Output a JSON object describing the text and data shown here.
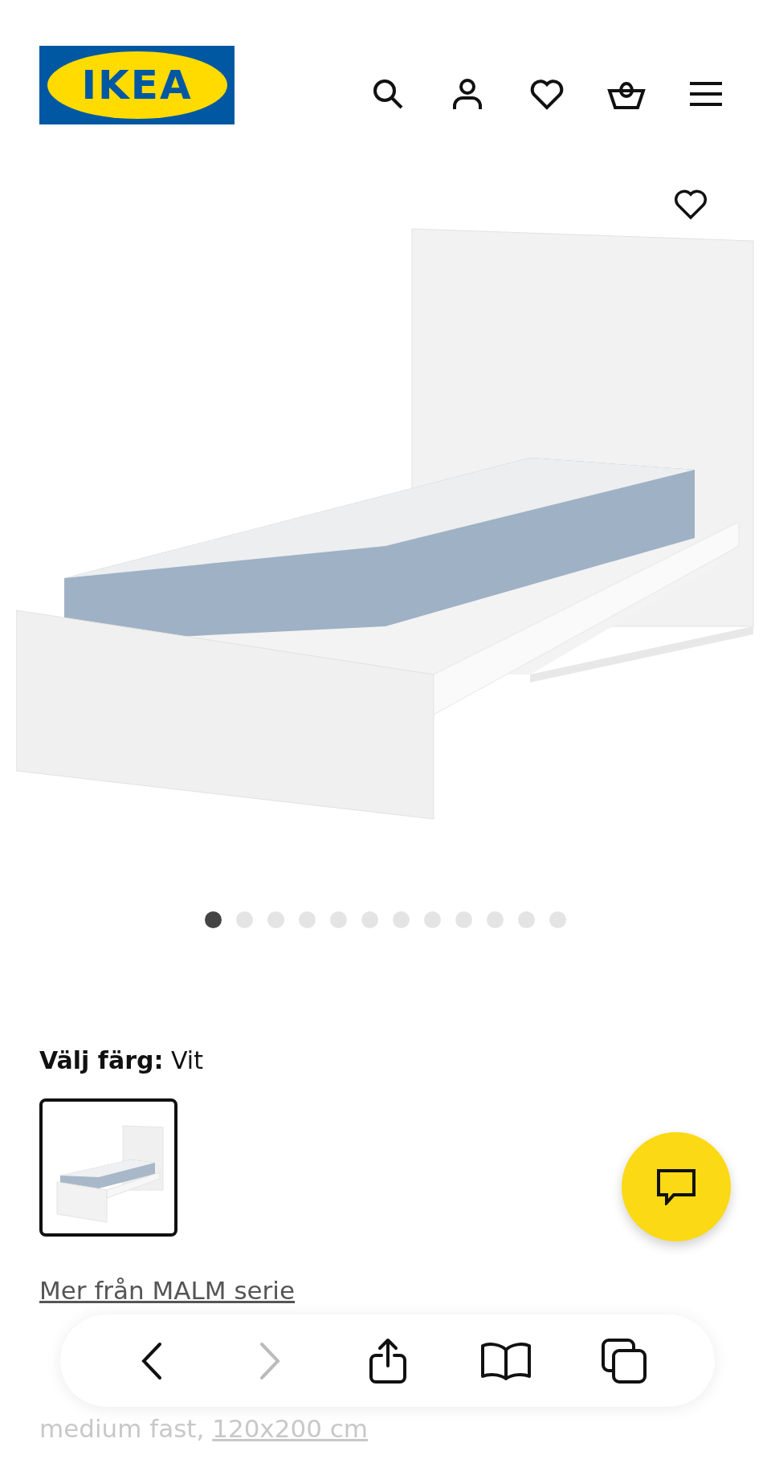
{
  "header": {
    "logo": "IKEA"
  },
  "gallery": {
    "dots": [
      {
        "selected": true
      },
      {
        "selected": false
      },
      {
        "selected": false
      },
      {
        "selected": false
      },
      {
        "selected": false
      },
      {
        "selected": false
      },
      {
        "selected": false
      },
      {
        "selected": false
      },
      {
        "selected": false
      },
      {
        "selected": false
      },
      {
        "selected": false
      },
      {
        "selected": false
      }
    ]
  },
  "color_picker": {
    "label": "Välj färg:",
    "value": "Vit",
    "swatches": [
      {
        "selected": true
      }
    ]
  },
  "series_link": "Mer från MALM serie",
  "product": {
    "description_2": "medium fast,",
    "size": "120x200 cm"
  }
}
